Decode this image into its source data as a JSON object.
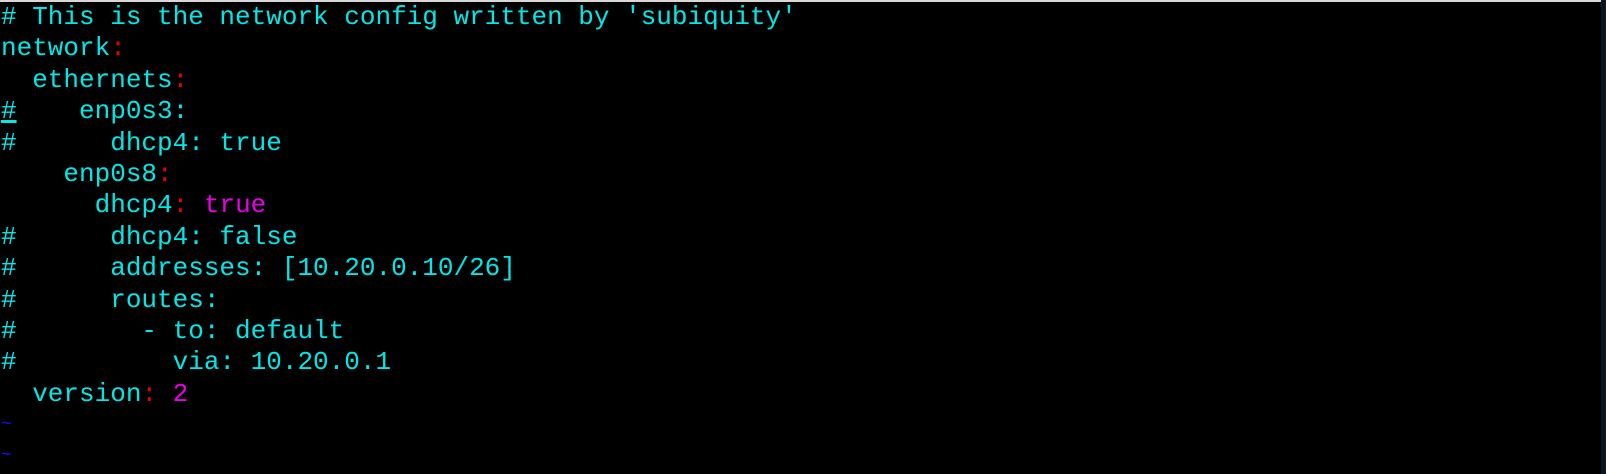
{
  "editor": {
    "colors": {
      "text": "#00e8e8",
      "punct": "#e80000",
      "value": "#e800e8",
      "tilde": "#1010ff",
      "background": "#000000"
    },
    "cursor": {
      "line": 4,
      "column": 1
    },
    "lines": [
      [
        {
          "t": "# This is the network config written by 'subiquity'",
          "c": "text"
        }
      ],
      [
        {
          "t": "network",
          "c": "text"
        },
        {
          "t": ":",
          "c": "punct"
        }
      ],
      [
        {
          "t": "  ethernets",
          "c": "text"
        },
        {
          "t": ":",
          "c": "punct"
        }
      ],
      [
        {
          "t": "#",
          "c": "text",
          "cursor": true
        },
        {
          "t": "    enp0s3:",
          "c": "text"
        }
      ],
      [
        {
          "t": "#      dhcp4: true",
          "c": "text"
        }
      ],
      [
        {
          "t": "    enp0s8",
          "c": "text"
        },
        {
          "t": ":",
          "c": "punct"
        }
      ],
      [
        {
          "t": "      dhcp4",
          "c": "text"
        },
        {
          "t": ":",
          "c": "punct"
        },
        {
          "t": " ",
          "c": "text"
        },
        {
          "t": "true",
          "c": "value"
        }
      ],
      [
        {
          "t": "#      dhcp4: false",
          "c": "text"
        }
      ],
      [
        {
          "t": "#      addresses: [10.20.0.10/26]",
          "c": "text"
        }
      ],
      [
        {
          "t": "#      routes:",
          "c": "text"
        }
      ],
      [
        {
          "t": "#        - to: default",
          "c": "text"
        }
      ],
      [
        {
          "t": "#          via: 10.20.0.1",
          "c": "text"
        }
      ],
      [
        {
          "t": "  version",
          "c": "text"
        },
        {
          "t": ":",
          "c": "punct"
        },
        {
          "t": " ",
          "c": "text"
        },
        {
          "t": "2",
          "c": "value"
        }
      ],
      [
        {
          "t": "~",
          "c": "tilde"
        }
      ],
      [
        {
          "t": "~",
          "c": "tilde"
        }
      ]
    ]
  }
}
